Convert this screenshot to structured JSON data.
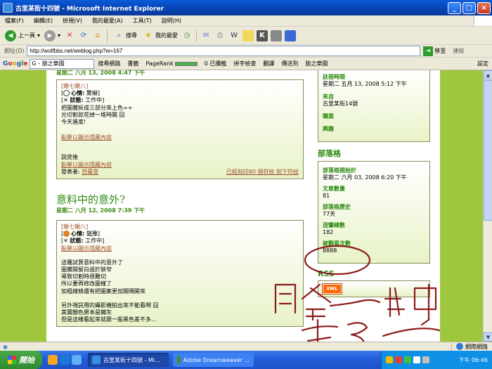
{
  "window": {
    "title": "古里某街十四號 - Microsoft Internet Explorer",
    "buttons": {
      "minimize": "_",
      "maximize": "□",
      "close": "×"
    }
  },
  "menubar": [
    "檔案(F)",
    "編輯(E)",
    "檢視(V)",
    "我的最愛(A)",
    "工具(T)",
    "說明(H)"
  ],
  "toolbar": {
    "back": "上一頁",
    "search": "搜尋",
    "favorites": "我的最愛"
  },
  "address": {
    "label": "網址(D)",
    "url": "http://wolfbbs.net/weblog.php?w=167",
    "go": "移至",
    "links": "連結"
  },
  "googlebar": {
    "logo": [
      "G",
      "o",
      "o",
      "g",
      "l",
      "e"
    ],
    "search_value": "G - 狼之樂園",
    "items": [
      "搜尋網路",
      "書籤",
      "PageRank",
      "0 已攔截",
      "拼字檢查",
      "翻譯",
      "傳送到",
      "狼之樂園"
    ],
    "settings": "設定"
  },
  "blog": {
    "top_meta": "星期二 八月 13, 2008 4:47 下午",
    "post1": {
      "cat": "[雜七雜八]",
      "mood_label": "心情:",
      "mood_value": "驚嚇",
      "status_label": "狀態:",
      "status_value": "工作中",
      "body": [
        "把圖騰拆成三部分來上色=+",
        "光切割就花掉一堆時間 囧",
        "今天進度!"
      ],
      "hidden_link": "點擊以顯示隱藏內容",
      "extra": "說皮後",
      "hidden_link2": "點擊以顯示隱藏內容",
      "poster_label": "發表者:",
      "poster": "芭蘿查",
      "actions": "已經刻印80 個符紋 刻下符紋"
    },
    "post2": {
      "title": "意料中的意外?",
      "meta": "星期二 八月 12, 2008 7:39 下午",
      "cat": "[雜七雜八]",
      "mood_label": "心情:",
      "mood_value": "猶豫",
      "status_label": "狀態:",
      "status_value": "工作中",
      "hidden_link": "點擊以顯示隱藏內容",
      "body": [
        "這羅試算意料中的意外了",
        "圖騰間留白過於狹窄",
        "導致切割時很難切",
        "所以要再修改圖樣了",
        "加粗線條還有把圖案更加間隔開來"
      ],
      "body2": [
        "另外視訊用的攝影機拍出來不能看啊 囧",
        "其實顏色原本是鐵灰",
        "但是這樣看起來就跟一般黑色差不多..."
      ]
    }
  },
  "sidebar": {
    "profile": [
      {
        "label": "註冊時間",
        "value": "星期二 五月 13, 2008 5:12 下午"
      },
      {
        "label": "來自",
        "value": "古里某街14號"
      },
      {
        "label": "職業",
        "value": ""
      },
      {
        "label": "興趣",
        "value": ""
      }
    ],
    "blog_heading": "部落格",
    "blog_info": [
      {
        "label": "部落格開始於",
        "value": "星期二 六月 03, 2008 6:20 下午"
      },
      {
        "label": "文章數量",
        "value": "81"
      },
      {
        "label": "部落格歷史",
        "value": "77天"
      },
      {
        "label": "迴響總數",
        "value": "182"
      },
      {
        "label": "被觀看次數",
        "value": "8888"
      }
    ],
    "rss_heading": "RSS",
    "xml_badge": "XML"
  },
  "handwriting": [
    "哈一些呵",
    "走 3 一"
  ],
  "statusbar": {
    "zone": "網際網路"
  },
  "taskbar": {
    "start": "開始",
    "tasks": [
      "古里某街十四號 - Mi...",
      "Adobe Dreamweaver ..."
    ],
    "clock": "下午 06:46"
  },
  "colors": {
    "ink": "#8b1a1a",
    "blog_green": "#2f8a12",
    "page_bg": "#9ec73e",
    "link_brown": "#a0522d"
  }
}
